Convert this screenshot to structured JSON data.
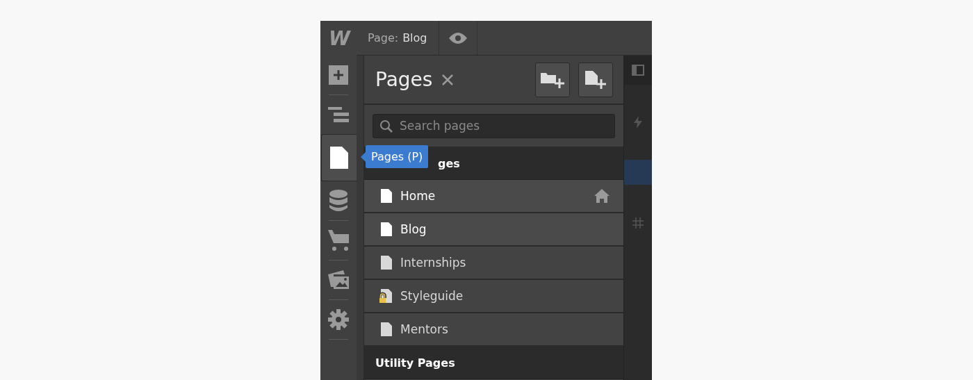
{
  "logo": "W",
  "topbar": {
    "page_label": "Page:",
    "page_name": "Blog"
  },
  "rail": [
    {
      "kind": "add",
      "selected": false
    },
    {
      "kind": "navigator",
      "selected": false
    },
    {
      "kind": "pages",
      "selected": true
    },
    {
      "kind": "cms",
      "selected": false
    },
    {
      "kind": "cart",
      "selected": false
    },
    {
      "kind": "assets",
      "selected": false
    },
    {
      "kind": "settings",
      "selected": false
    }
  ],
  "tooltip": "Pages (P)",
  "panel": {
    "title": "Pages",
    "search": {
      "placeholder": "Search pages"
    }
  },
  "sections": [
    {
      "title": "ges",
      "pages": [
        {
          "name": "Home",
          "highlighted": true,
          "home": true,
          "locked": false
        },
        {
          "name": "Blog",
          "highlighted": true,
          "home": false,
          "locked": false
        },
        {
          "name": "Internships",
          "highlighted": false,
          "home": false,
          "locked": false
        },
        {
          "name": "Styleguide",
          "highlighted": false,
          "home": false,
          "locked": true
        },
        {
          "name": "Mentors",
          "highlighted": false,
          "home": false,
          "locked": false
        }
      ]
    },
    {
      "title": "Utility Pages"
    }
  ],
  "right_rail": [
    {
      "kind": "panel",
      "selected": false
    },
    {
      "kind": "bolt",
      "selected": false
    },
    {
      "kind": "blank",
      "selected": true
    },
    {
      "kind": "hash",
      "selected": false
    }
  ]
}
